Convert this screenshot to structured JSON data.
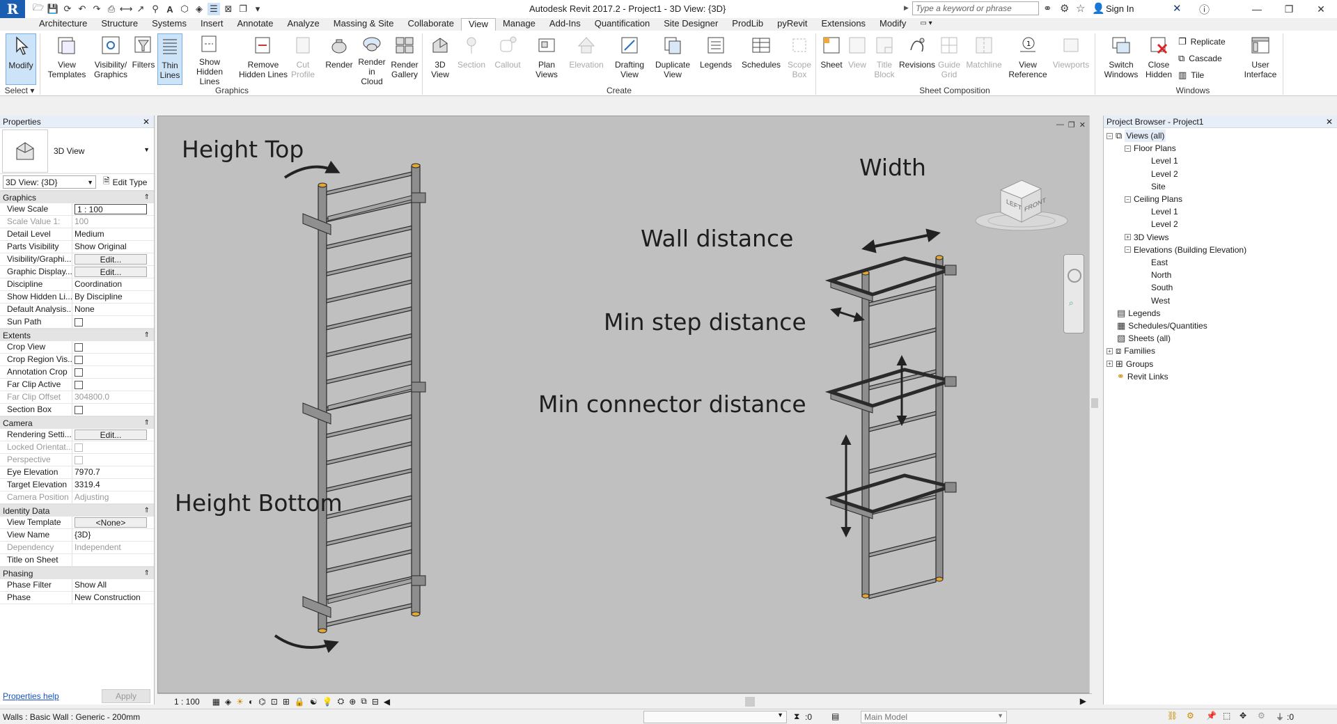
{
  "app": {
    "title": "Autodesk Revit 2017.2 -    Project1 - 3D View: {3D}",
    "logo": "R",
    "search_placeholder": "Type a keyword or phrase",
    "signin": "Sign In"
  },
  "tabs": [
    "Architecture",
    "Structure",
    "Systems",
    "Insert",
    "Annotate",
    "Analyze",
    "Massing & Site",
    "Collaborate",
    "View",
    "Manage",
    "Add-Ins",
    "Quantification",
    "Site Designer",
    "ProdLib",
    "pyRevit",
    "Extensions",
    "Modify"
  ],
  "active_tab": "View",
  "ribbon": {
    "select": {
      "label": "Modify",
      "panel": "Select"
    },
    "graphics": {
      "panel": "Graphics",
      "buttons": [
        "View\nTemplates",
        "Visibility/\nGraphics",
        "Filters",
        "Thin\nLines",
        "Show\nHidden Lines",
        "Remove\nHidden Lines",
        "Cut\nProfile",
        "Render",
        "Render\nin Cloud",
        "Render\nGallery"
      ]
    },
    "create": {
      "panel": "Create",
      "buttons": [
        "3D\nView",
        "Section",
        "Callout",
        "Plan\nViews",
        "Elevation",
        "Drafting\nView",
        "Duplicate\nView",
        "Legends",
        "Schedules",
        "Scope\nBox"
      ]
    },
    "sheet": {
      "panel": "Sheet Composition",
      "buttons": [
        "Sheet",
        "View",
        "Title\nBlock",
        "Revisions",
        "Guide\nGrid",
        "Matchline",
        "View\nReference",
        "Viewports"
      ]
    },
    "windows": {
      "panel": "Windows",
      "buttons": [
        "Switch\nWindows",
        "Close\nHidden"
      ],
      "small": [
        "Replicate",
        "Cascade",
        "Tile"
      ],
      "ui": "User\nInterface"
    }
  },
  "properties": {
    "title": "Properties",
    "type_name": "3D View",
    "instance": "3D View: {3D}",
    "edit_type": "Edit Type",
    "groups": [
      {
        "name": "Graphics",
        "rows": [
          {
            "k": "View Scale",
            "v": "1 : 100",
            "style": "boxed"
          },
          {
            "k": "Scale Value    1:",
            "v": "100",
            "style": "dim"
          },
          {
            "k": "Detail Level",
            "v": "Medium"
          },
          {
            "k": "Parts Visibility",
            "v": "Show Original"
          },
          {
            "k": "Visibility/Graphi...",
            "v": "Edit...",
            "style": "btn"
          },
          {
            "k": "Graphic Display...",
            "v": "Edit...",
            "style": "btn"
          },
          {
            "k": "Discipline",
            "v": "Coordination"
          },
          {
            "k": "Show Hidden Li...",
            "v": "By Discipline"
          },
          {
            "k": "Default Analysis...",
            "v": "None"
          },
          {
            "k": "Sun Path",
            "v": "",
            "style": "chk"
          }
        ]
      },
      {
        "name": "Extents",
        "rows": [
          {
            "k": "Crop View",
            "v": "",
            "style": "chk"
          },
          {
            "k": "Crop Region Vis...",
            "v": "",
            "style": "chk"
          },
          {
            "k": "Annotation Crop",
            "v": "",
            "style": "chk"
          },
          {
            "k": "Far Clip Active",
            "v": "",
            "style": "chk"
          },
          {
            "k": "Far Clip Offset",
            "v": "304800.0",
            "style": "dim"
          },
          {
            "k": "Section Box",
            "v": "",
            "style": "chk"
          }
        ]
      },
      {
        "name": "Camera",
        "rows": [
          {
            "k": "Rendering Setti...",
            "v": "Edit...",
            "style": "btn"
          },
          {
            "k": "Locked Orientat...",
            "v": "",
            "style": "chkdim"
          },
          {
            "k": "Perspective",
            "v": "",
            "style": "chkdim"
          },
          {
            "k": "Eye Elevation",
            "v": "7970.7"
          },
          {
            "k": "Target Elevation",
            "v": "3319.4"
          },
          {
            "k": "Camera Position",
            "v": "Adjusting",
            "style": "dim"
          }
        ]
      },
      {
        "name": "Identity Data",
        "rows": [
          {
            "k": "View Template",
            "v": "<None>",
            "style": "btn"
          },
          {
            "k": "View Name",
            "v": "{3D}"
          },
          {
            "k": "Dependency",
            "v": "Independent",
            "style": "dim"
          },
          {
            "k": "Title on Sheet",
            "v": ""
          }
        ]
      },
      {
        "name": "Phasing",
        "rows": [
          {
            "k": "Phase Filter",
            "v": "Show All"
          },
          {
            "k": "Phase",
            "v": "New Construction"
          }
        ]
      }
    ],
    "help": "Properties help",
    "apply": "Apply"
  },
  "canvas": {
    "annotations": [
      "Height Top",
      "Height Bottom",
      "Width",
      "Wall distance",
      "Min step distance",
      "Min connector distance"
    ],
    "viewcube": {
      "left": "LEFT",
      "front": "FRONT"
    }
  },
  "view_control": {
    "scale": "1 : 100"
  },
  "browser": {
    "title": "Project Browser - Project1",
    "nodes": [
      {
        "label": "Views (all)",
        "level": 0,
        "toggle": "-",
        "icon": "views"
      },
      {
        "label": "Floor Plans",
        "level": 1,
        "toggle": "-"
      },
      {
        "label": "Level 1",
        "level": 2
      },
      {
        "label": "Level 2",
        "level": 2
      },
      {
        "label": "Site",
        "level": 2
      },
      {
        "label": "Ceiling Plans",
        "level": 1,
        "toggle": "-"
      },
      {
        "label": "Level 1",
        "level": 2
      },
      {
        "label": "Level 2",
        "level": 2
      },
      {
        "label": "3D Views",
        "level": 1,
        "toggle": "+"
      },
      {
        "label": "Elevations (Building Elevation)",
        "level": 1,
        "toggle": "-"
      },
      {
        "label": "East",
        "level": 2
      },
      {
        "label": "North",
        "level": 2
      },
      {
        "label": "South",
        "level": 2
      },
      {
        "label": "West",
        "level": 2
      },
      {
        "label": "Legends",
        "level": 0,
        "icon": "legend"
      },
      {
        "label": "Schedules/Quantities",
        "level": 0,
        "icon": "schedule"
      },
      {
        "label": "Sheets (all)",
        "level": 0,
        "icon": "sheet"
      },
      {
        "label": "Families",
        "level": 0,
        "toggle": "+",
        "icon": "family"
      },
      {
        "label": "Groups",
        "level": 0,
        "toggle": "+",
        "icon": "group"
      },
      {
        "label": "Revit Links",
        "level": 0,
        "icon": "link"
      }
    ]
  },
  "status": {
    "text": "Walls : Basic Wall : Generic - 200mm",
    "workset_count": ":0",
    "model": "Main Model",
    "filter_count": ":0"
  },
  "colors": {
    "accent": "#1b5db0",
    "canvas": "#c0c0c0",
    "panel_header": "#e7eef7"
  }
}
